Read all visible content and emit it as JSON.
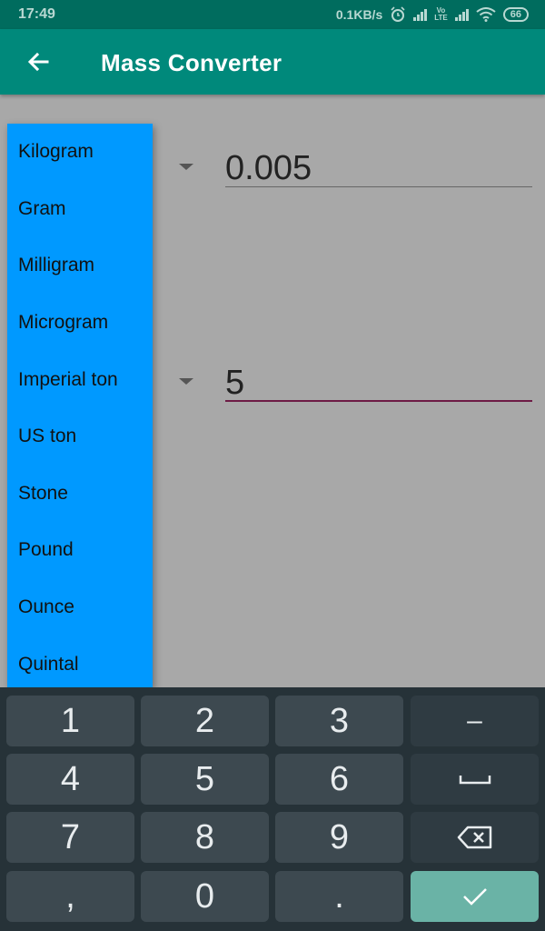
{
  "status_bar": {
    "time": "17:49",
    "speed": "0.1KB/s",
    "battery": "66",
    "lte_label_top": "Vo",
    "lte_label_bottom": "LTE"
  },
  "app_bar": {
    "title": "Mass Converter",
    "back_icon": "arrow-back-icon"
  },
  "converter": {
    "top_value": "0.005",
    "bottom_value": "5"
  },
  "unit_menu": {
    "items": [
      "Kilogram",
      "Gram",
      "Milligram",
      "Microgram",
      "Imperial ton",
      "US ton",
      "Stone",
      "Pound",
      "Ounce",
      "Quintal"
    ]
  },
  "keyboard": {
    "keys": [
      "1",
      "2",
      "3",
      "–",
      "4",
      "5",
      "6",
      "␣",
      "7",
      "8",
      "9",
      "⌫",
      ",",
      "0",
      ".",
      "✓"
    ],
    "colors": {
      "background": "#263238",
      "key": "#3d4950",
      "action_key": "#6ab3a6"
    }
  },
  "colors": {
    "app_bar": "#00897b",
    "status_bar": "#006c5e",
    "menu": "#0099ff",
    "focused_underline": "#6d1b45"
  }
}
